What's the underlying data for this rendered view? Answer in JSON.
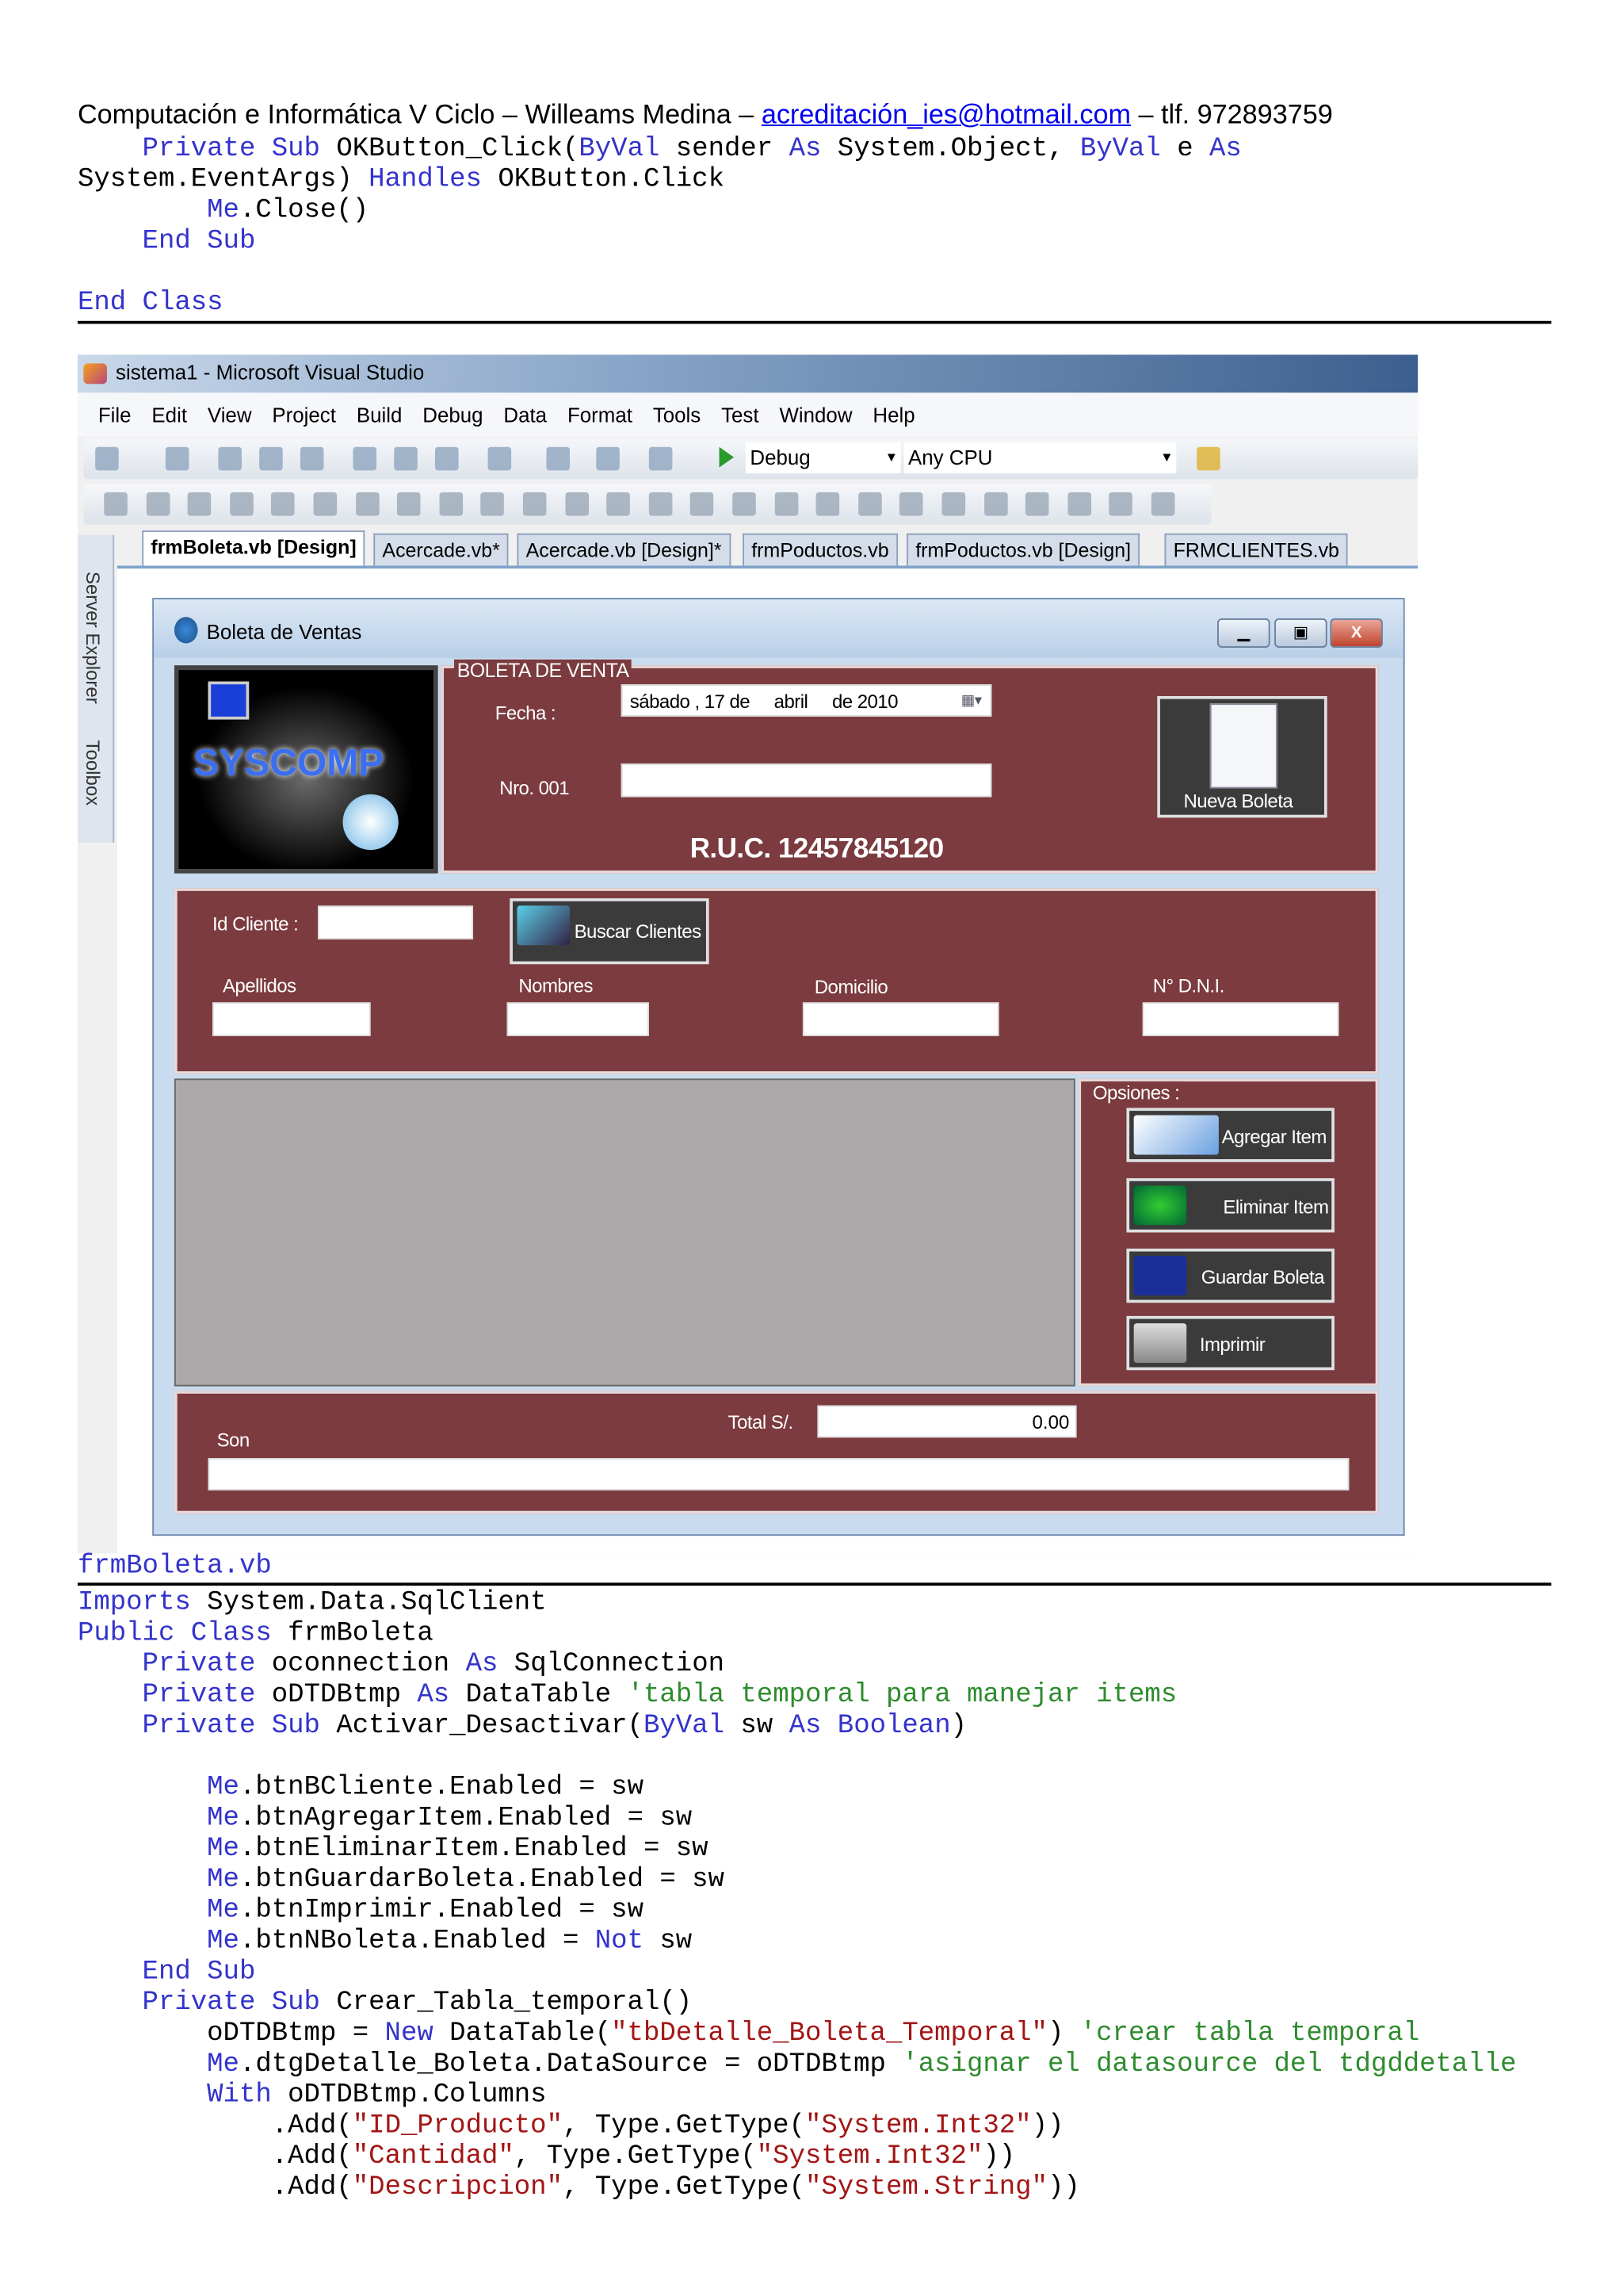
{
  "header": {
    "prefix": "Computación e Informática V Ciclo – Willeams Medina – ",
    "email": "acreditación_ies@hotmail.com",
    "suffix": " – tlf. 972893759"
  },
  "code_top": [
    [
      [
        "k",
        "    Private Sub "
      ],
      [
        "n",
        "OKButton_Click("
      ],
      [
        "k",
        "ByVal"
      ],
      [
        "n",
        " sender "
      ],
      [
        "k",
        "As"
      ],
      [
        "n",
        " System.Object, "
      ],
      [
        "k",
        "ByVal"
      ],
      [
        "n",
        " e "
      ],
      [
        "k",
        "As"
      ]
    ],
    [
      [
        "n",
        "System.EventArgs) "
      ],
      [
        "k",
        "Handles"
      ],
      [
        "n",
        " OKButton.Click"
      ]
    ],
    [
      [
        "k",
        "        Me"
      ],
      [
        "n",
        ".Close()"
      ]
    ],
    [
      [
        "k",
        "    End Sub"
      ]
    ],
    [],
    [
      [
        "k",
        "End Class"
      ]
    ]
  ],
  "caption": "frmBoleta.vb",
  "code_bottom": [
    [
      [
        "k",
        "Imports"
      ],
      [
        "n",
        " System.Data.SqlClient"
      ]
    ],
    [
      [
        "k",
        "Public Class"
      ],
      [
        "n",
        " frmBoleta"
      ]
    ],
    [
      [
        "k",
        "    Private"
      ],
      [
        "n",
        " oconnection "
      ],
      [
        "k",
        "As"
      ],
      [
        "n",
        " SqlConnection"
      ]
    ],
    [
      [
        "k",
        "    Private"
      ],
      [
        "n",
        " oDTDBtmp "
      ],
      [
        "k",
        "As"
      ],
      [
        "n",
        " DataTable "
      ],
      [
        "c",
        "'tabla temporal para manejar items"
      ]
    ],
    [
      [
        "k",
        "    Private Sub"
      ],
      [
        "n",
        " Activar_Desactivar("
      ],
      [
        "k",
        "ByVal"
      ],
      [
        "n",
        " sw "
      ],
      [
        "k",
        "As Boolean"
      ],
      [
        "n",
        ")"
      ]
    ],
    [],
    [
      [
        "k",
        "        Me"
      ],
      [
        "n",
        ".btnBCliente.Enabled = sw"
      ]
    ],
    [
      [
        "k",
        "        Me"
      ],
      [
        "n",
        ".btnAgregarItem.Enabled = sw"
      ]
    ],
    [
      [
        "k",
        "        Me"
      ],
      [
        "n",
        ".btnEliminarItem.Enabled = sw"
      ]
    ],
    [
      [
        "k",
        "        Me"
      ],
      [
        "n",
        ".btnGuardarBoleta.Enabled = sw"
      ]
    ],
    [
      [
        "k",
        "        Me"
      ],
      [
        "n",
        ".btnImprimir.Enabled = sw"
      ]
    ],
    [
      [
        "k",
        "        Me"
      ],
      [
        "n",
        ".btnNBoleta.Enabled = "
      ],
      [
        "k",
        "Not"
      ],
      [
        "n",
        " sw"
      ]
    ],
    [
      [
        "k",
        "    End Sub"
      ]
    ],
    [
      [
        "k",
        "    Private Sub"
      ],
      [
        "n",
        " Crear_Tabla_temporal()"
      ]
    ],
    [
      [
        "n",
        "        oDTDBtmp = "
      ],
      [
        "k",
        "New"
      ],
      [
        "n",
        " DataTable("
      ],
      [
        "s",
        "\"tbDetalle_Boleta_Temporal\""
      ],
      [
        "n",
        ") "
      ],
      [
        "c",
        "'crear tabla temporal"
      ]
    ],
    [
      [
        "k",
        "        Me"
      ],
      [
        "n",
        ".dtgDetalle_Boleta.DataSource = oDTDBtmp "
      ],
      [
        "c",
        "'asignar el datasource del tdgddetalle"
      ]
    ],
    [
      [
        "k",
        "        With"
      ],
      [
        "n",
        " oDTDBtmp.Columns"
      ]
    ],
    [
      [
        "n",
        "            .Add("
      ],
      [
        "s",
        "\"ID_Producto\""
      ],
      [
        "n",
        ", Type.GetType("
      ],
      [
        "s",
        "\"System.Int32\""
      ],
      [
        "n",
        "))"
      ]
    ],
    [
      [
        "n",
        "            .Add("
      ],
      [
        "s",
        "\"Cantidad\""
      ],
      [
        "n",
        ", Type.GetType("
      ],
      [
        "s",
        "\"System.Int32\""
      ],
      [
        "n",
        "))"
      ]
    ],
    [
      [
        "n",
        "            .Add("
      ],
      [
        "s",
        "\"Descripcion\""
      ],
      [
        "n",
        ", Type.GetType("
      ],
      [
        "s",
        "\"System.String\""
      ],
      [
        "n",
        "))"
      ]
    ]
  ],
  "vs": {
    "title": "sistema1 - Microsoft Visual Studio",
    "menu": [
      "File",
      "Edit",
      "View",
      "Project",
      "Build",
      "Debug",
      "Data",
      "Format",
      "Tools",
      "Test",
      "Window",
      "Help"
    ],
    "config": "Debug",
    "platform": "Any CPU",
    "tabs": [
      "frmBoleta.vb [Design]",
      "Acercade.vb*",
      "Acercade.vb [Design]*",
      "frmPoductos.vb",
      "frmPoductos.vb [Design]",
      "FRMCLIENTES.vb"
    ],
    "side": [
      "Server Explorer",
      "Toolbox"
    ]
  },
  "form": {
    "title": "Boleta de Ventas",
    "logo_text": "SYSCOMP",
    "group_boleta": "BOLETA DE VENTA",
    "fecha_label": "Fecha :",
    "fecha": {
      "day": "sábado",
      "num": ", 17 de",
      "month": "abril",
      "year": "de 2010"
    },
    "nro_label": "Nro. 001",
    "nro_value": "",
    "ruc": "R.U.C. 12457845120",
    "nueva_boleta": "Nueva Boleta",
    "id_cliente_label": "Id Cliente :",
    "buscar": "Buscar Clientes",
    "fields": [
      "Apellidos",
      "Nombres",
      "Domicilio",
      "N° D.N.I."
    ],
    "group_opciones": "Opsiones :",
    "actions": [
      "Agregar Item",
      "Eliminar Item",
      "Guardar Boleta",
      "Imprimir"
    ],
    "total_label": "Total S/.",
    "total_value": "0.00",
    "son_label": "Son"
  },
  "colors": {
    "panel": "#7b3b3f",
    "grid": "#aba9aa",
    "keyword": "#3333cc",
    "string": "#a31515",
    "comment": "#2e8b2e"
  }
}
